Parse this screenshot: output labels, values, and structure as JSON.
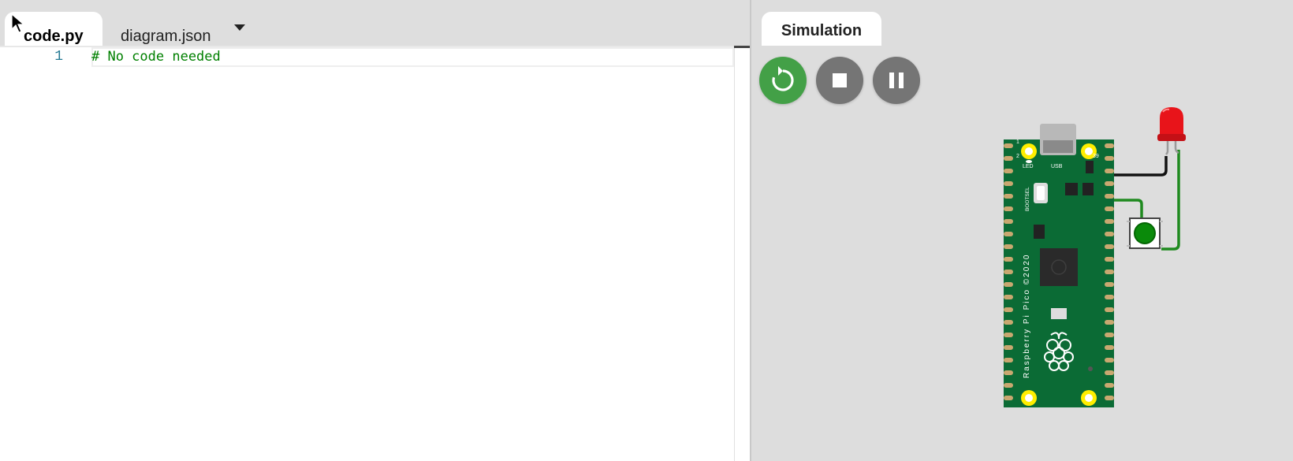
{
  "editor": {
    "tabs": [
      {
        "label": "code.py",
        "active": true
      },
      {
        "label": "diagram.json",
        "active": false
      }
    ],
    "lines": [
      {
        "number": "1",
        "text": "# No code needed",
        "kind": "comment"
      }
    ]
  },
  "simulation": {
    "tab_label": "Simulation",
    "controls": [
      {
        "name": "restart",
        "icon": "restart-icon",
        "color": "#43a047"
      },
      {
        "name": "stop",
        "icon": "stop-icon",
        "color": "#757575"
      },
      {
        "name": "pause",
        "icon": "pause-icon",
        "color": "#757575"
      }
    ],
    "board": {
      "silkscreen": "Raspberry Pi Pico ©2020",
      "labels": {
        "led": "LED",
        "usb": "USB",
        "bootsel": "BOOTSEL",
        "pin1": "1",
        "pin2": "2",
        "pin39": "39"
      },
      "color": "#0b6b35"
    },
    "led_color": "#e8141a",
    "button_color": "#0a8a0a",
    "wire_colors": {
      "ground": "#111111",
      "signal": "#1f8a1f"
    }
  }
}
